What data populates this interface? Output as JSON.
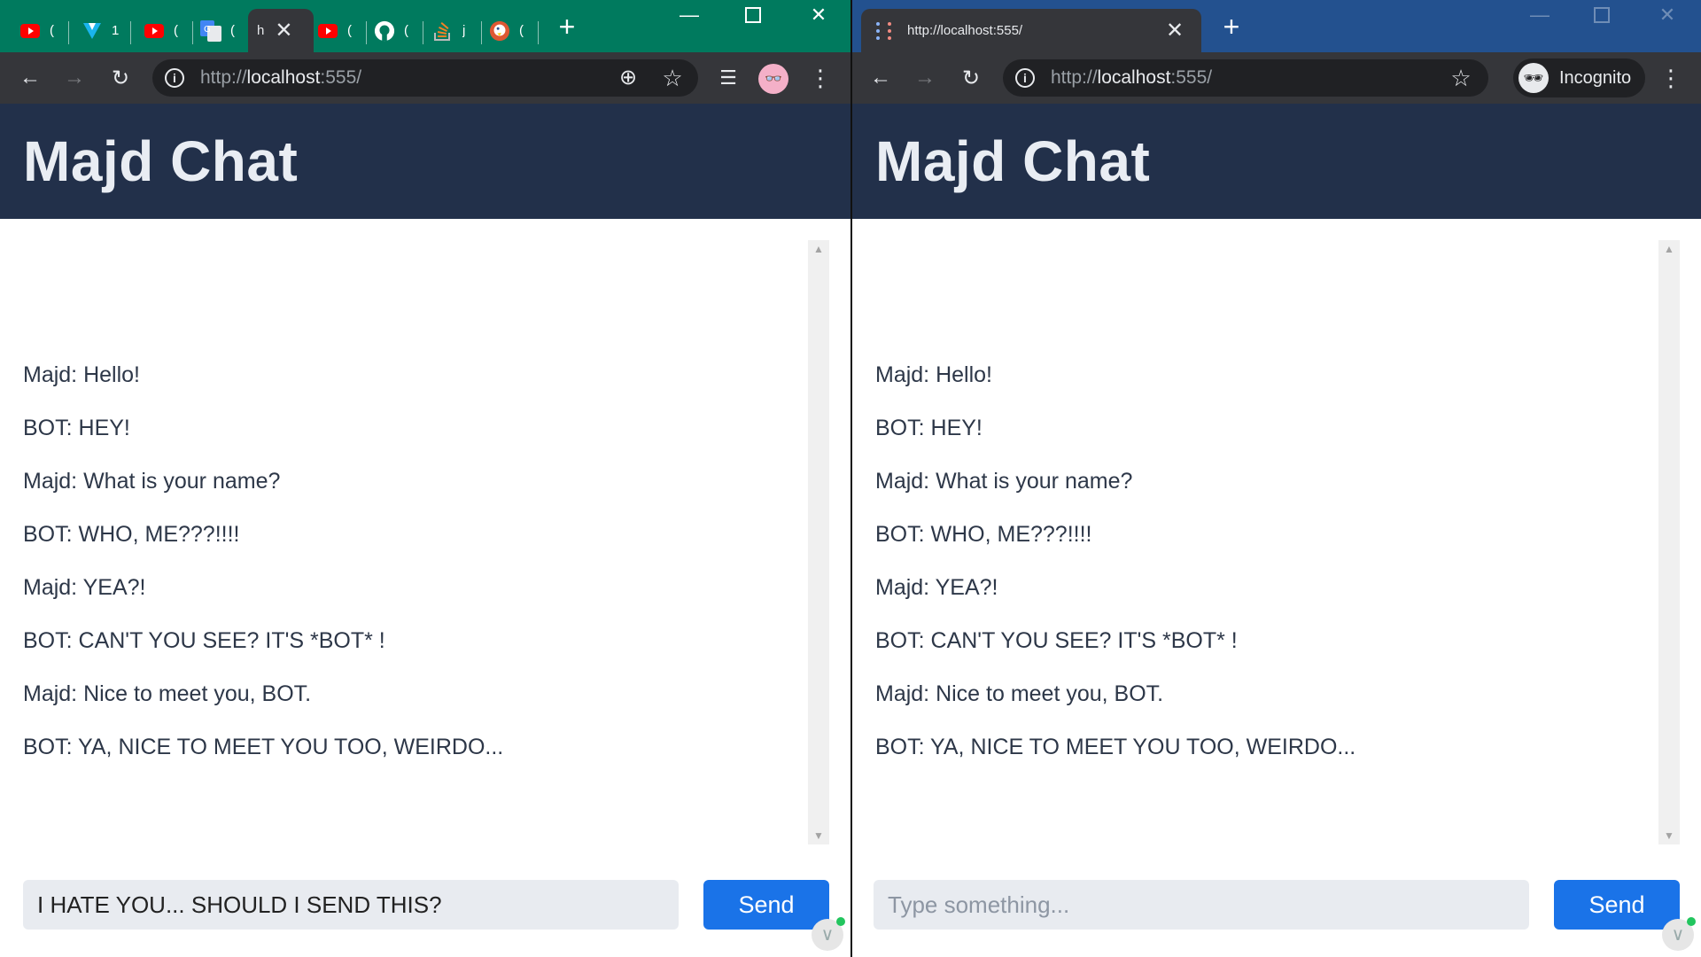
{
  "colors": {
    "left_frame": "#007a5e",
    "right_frame": "#23518f",
    "toolbar": "#35363a",
    "app_header": "#22304a",
    "send_button": "#1a73e8"
  },
  "left": {
    "tabs": [
      {
        "icon": "youtube-icon",
        "text": "("
      },
      {
        "icon": "vuetify-icon",
        "text": "1"
      },
      {
        "icon": "youtube-icon",
        "text": "("
      },
      {
        "icon": "google-translate-icon",
        "text": "("
      },
      {
        "icon": "blank-page-icon",
        "text": "h",
        "active": true
      },
      {
        "icon": "youtube-icon",
        "text": "("
      },
      {
        "icon": "github-icon",
        "text": "("
      },
      {
        "icon": "stackoverflow-icon",
        "text": "j"
      },
      {
        "icon": "duckduckgo-icon",
        "text": "("
      }
    ],
    "url_scheme": "http://",
    "url_host": "localhost",
    "url_rest": ":555/",
    "app_title": "Majd Chat",
    "input_value": "I HATE YOU... SHOULD I SEND THIS?",
    "send_label": "Send"
  },
  "right": {
    "tab_title": "http://localhost:555/",
    "url_scheme": "http://",
    "url_host": "localhost",
    "url_rest": ":555/",
    "incognito_label": "Incognito",
    "app_title": "Majd Chat",
    "input_placeholder": "Type something...",
    "send_label": "Send"
  },
  "messages": [
    "Majd: Hello!",
    "BOT: HEY!",
    "Majd: What is your name?",
    "BOT: WHO, ME???!!!!",
    "Majd: YEA?!",
    "BOT: CAN'T YOU SEE? IT'S *BOT* !",
    "Majd: Nice to meet you, BOT.",
    "BOT: YA, NICE TO MEET YOU TOO, WEIRDO..."
  ]
}
